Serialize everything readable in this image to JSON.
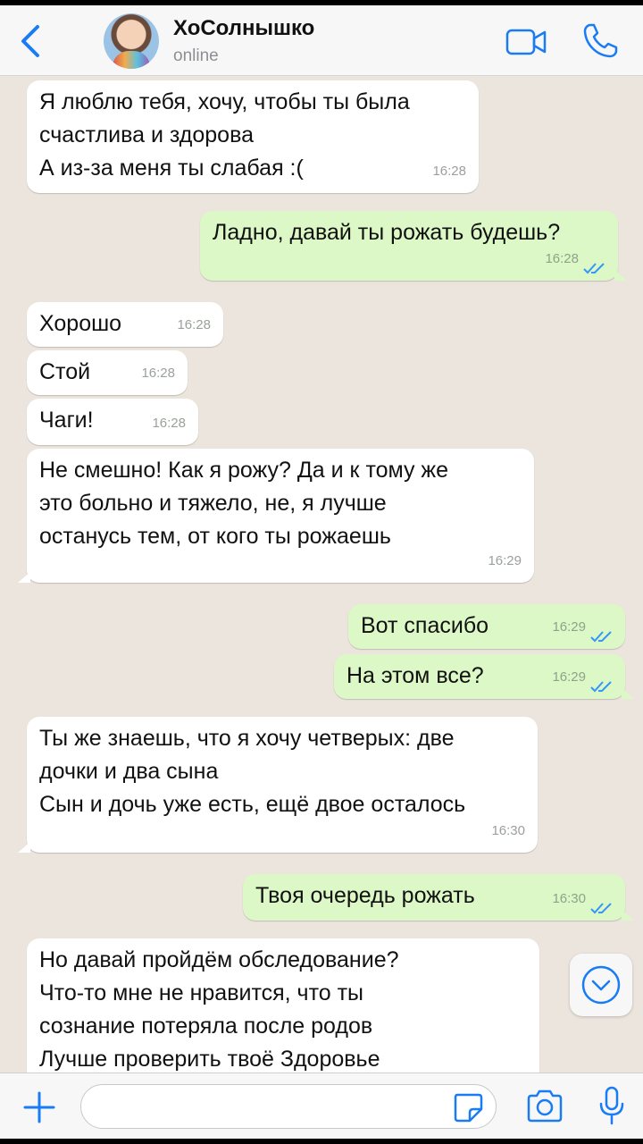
{
  "header": {
    "contact_name": "ХоСолнышко",
    "status": "online",
    "icons": [
      "back-chevron-icon",
      "video-call-icon",
      "phone-icon"
    ]
  },
  "messages": [
    {
      "direction": "in",
      "text": "Я люблю тебя, хочу, чтобы ты была\nсчастлива и здорова\nА из-за меня ты слабая :(",
      "time": "16:28"
    },
    {
      "direction": "out",
      "text": "Ладно, давай ты рожать будешь?",
      "time": "16:28",
      "read": true
    },
    {
      "direction": "in",
      "text": "Хорошо",
      "time": "16:28"
    },
    {
      "direction": "in",
      "text": "Стой",
      "time": "16:28"
    },
    {
      "direction": "in",
      "text": "Чаги!",
      "time": "16:28"
    },
    {
      "direction": "in",
      "text": "Не смешно! Как я рожу? Да и к тому же\nэто больно и тяжело, не, я лучше\nостанусь тем, от кого ты рожаешь",
      "time": "16:29"
    },
    {
      "direction": "out",
      "text": "Вот спасибо",
      "time": "16:29",
      "read": true
    },
    {
      "direction": "out",
      "text": "На этом все?",
      "time": "16:29",
      "read": true
    },
    {
      "direction": "in",
      "text": "Ты же знаешь, что я хочу четверых: две\nдочки и два сына\nСын и дочь уже есть, ещё двое осталось",
      "time": "16:30"
    },
    {
      "direction": "out",
      "text": "Твоя очередь рожать",
      "time": "16:30",
      "read": true
    },
    {
      "direction": "in",
      "text": "Но давай пройдём обследование?\nЧто-то мне не нравится, что ты\nсознание потеряла после родов\nЛучше проверить твоё Здоровье",
      "time": ""
    }
  ],
  "input": {
    "placeholder": ""
  },
  "colors": {
    "chat_background": "#ece5dd",
    "incoming_bubble": "#ffffff",
    "outgoing_bubble": "#dcf8c6",
    "accent": "#1a7cf5"
  }
}
